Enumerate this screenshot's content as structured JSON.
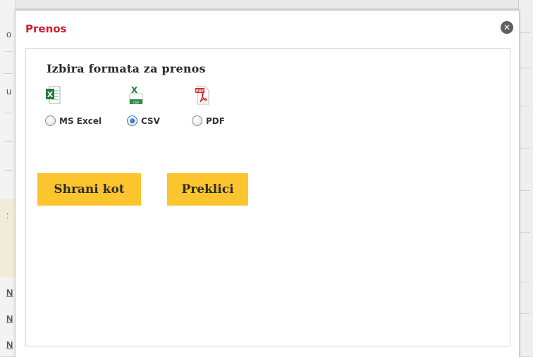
{
  "dialog": {
    "title": "Prenos",
    "close_symbol": "✕"
  },
  "export": {
    "heading": "Izbira formata za prenos",
    "formats": [
      {
        "label": "MS Excel",
        "icon": "excel-file-icon",
        "selected": false
      },
      {
        "label": "CSV",
        "icon": "csv-file-icon",
        "selected": true
      },
      {
        "label": "PDF",
        "icon": "pdf-file-icon",
        "selected": false
      }
    ],
    "selected_format": "CSV"
  },
  "actions": {
    "save_label": "Shrani kot",
    "cancel_label": "Preklici"
  },
  "background": {
    "left_letters": [
      "o",
      "u",
      ":",
      "N",
      "N",
      "N"
    ]
  },
  "colors": {
    "title": "#d21b2f",
    "button": "#fcc42d",
    "excel_green": "#1e7c3c",
    "pdf_red": "#d32f2f"
  }
}
